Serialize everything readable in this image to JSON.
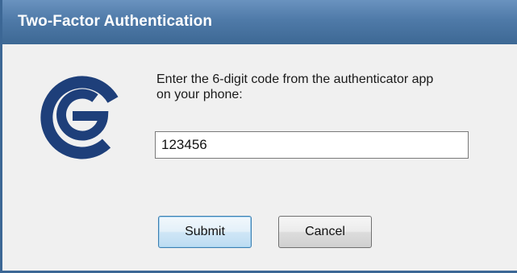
{
  "window": {
    "title": "Two-Factor Authentication"
  },
  "logo": {
    "icon": "authenticator-logo-icon",
    "color": "#1e3f7a"
  },
  "prompt": {
    "line1": "Enter the 6-digit code from the authenticator app",
    "line2": "on your phone:"
  },
  "code_field": {
    "value": "123456"
  },
  "buttons": {
    "submit_label": "Submit",
    "cancel_label": "Cancel"
  },
  "colors": {
    "titlebar": "#4f7aa8",
    "title_text": "#ffffff",
    "body": "#f0f0f0",
    "default_button_border": "#3c7fb1"
  }
}
